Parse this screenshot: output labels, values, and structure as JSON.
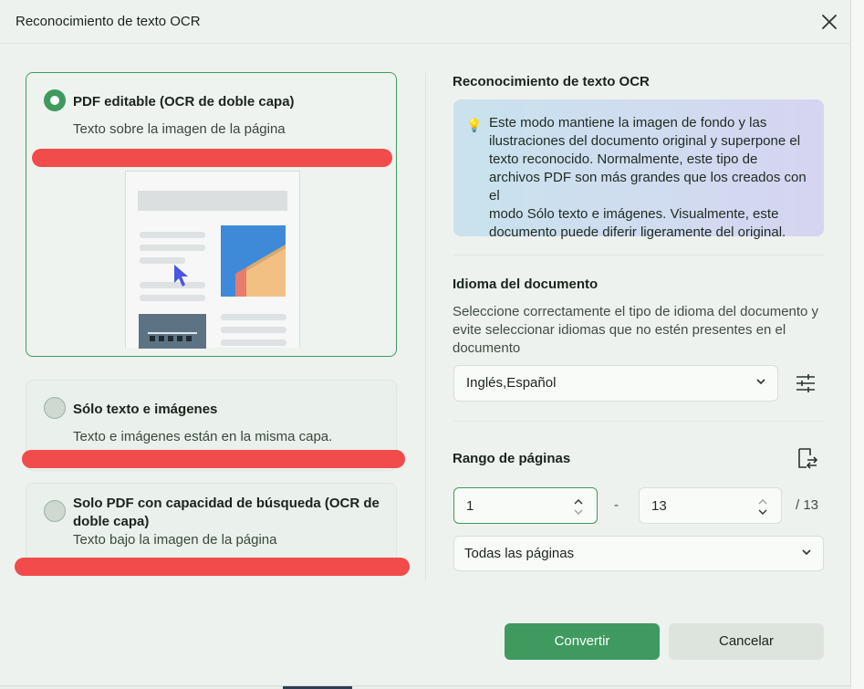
{
  "dialog": {
    "title": "Reconocimiento de texto OCR"
  },
  "options": [
    {
      "title": "PDF editable (OCR de doble capa)",
      "subtitle": "Texto sobre la imagen de la página",
      "selected": true
    },
    {
      "title": "Sólo texto e imágenes",
      "subtitle": "Texto e imágenes están en la misma capa.",
      "selected": false
    },
    {
      "title_line1": "Solo PDF con capacidad de búsqueda (OCR de",
      "title_line2": "doble capa)",
      "subtitle": "Texto bajo la imagen de la página",
      "selected": false
    }
  ],
  "info": {
    "title": "Reconocimiento de texto OCR",
    "tip_icon": "lightbulb-icon",
    "tip_lines": [
      "Este modo mantiene la imagen de fondo y las",
      "ilustraciones del documento original y superpone el",
      "texto reconocido. Normalmente, este tipo de",
      "archivos PDF son más grandes que los creados con el",
      "modo Sólo texto e imágenes. Visualmente, este",
      "documento puede diferir ligeramente del original."
    ]
  },
  "language": {
    "title": "Idioma del documento",
    "desc_lines": [
      "Seleccione correctamente el tipo de idioma del documento y",
      "evite seleccionar idiomas que no estén presentes en el",
      "documento"
    ],
    "selected": "Inglés,Español"
  },
  "pages": {
    "title": "Rango de páginas",
    "from": "1",
    "separator": "-",
    "to": "13",
    "total": "/ 13",
    "range_option": "Todas las páginas"
  },
  "buttons": {
    "convert": "Convertir",
    "cancel": "Cancelar"
  },
  "colors": {
    "accent": "#3f9a5f",
    "redact": "#f24b4b"
  }
}
